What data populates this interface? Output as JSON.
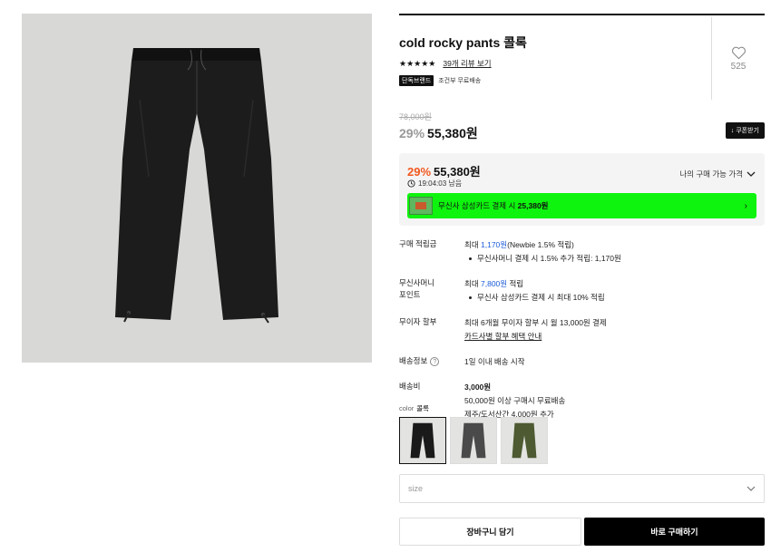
{
  "product": {
    "title": "cold rocky pants 콜록",
    "stars": "★★★★★",
    "review_link": "39개 리뷰 보기",
    "badge_exclusive": "단독브랜드",
    "badge_shipping": "조건부 무료배송",
    "like_count": "525",
    "image_alt": "black pants"
  },
  "price": {
    "original": "78,000원",
    "discount_pct": "29%",
    "current": "55,380원",
    "coupon_label": "↓ 쿠폰받기"
  },
  "my_price": {
    "discount_pct": "29%",
    "price": "55,380원",
    "timer": "19:04:03 남음",
    "label": "나의 구매 가능 가격",
    "card_text_prefix": "무신사 삼성카드 결제 시",
    "card_price": "25,380원",
    "banner_color": "#0ef40e",
    "discount_color": "#f2581f"
  },
  "details": {
    "points_label": "구매 적립금",
    "points_prefix": "최대",
    "points_value": "1,170원",
    "points_suffix": "(Newbie 1.5% 적립)",
    "points_sub": "무신사머니 결제 시 1.5% 추가 적립: 1,170원",
    "money_label_1": "무신사머니",
    "money_label_2": "포인트",
    "money_prefix": "최대",
    "money_value": "7,800원",
    "money_suffix": "적립",
    "money_sub": "무신사 삼성카드 결제 시 최대 10% 적립",
    "installment_label": "무이자 할부",
    "installment_text": "최대 6개월 무이자 할부 시 월 13,000원 결제",
    "installment_link": "카드사별 할부 혜택 안내",
    "delivery_label": "배송정보",
    "delivery_text": "1일 이내 배송 시작",
    "fee_label": "배송비",
    "fee_value": "3,000원",
    "fee_line2": "50,000원 이상 구매시 무료배송",
    "fee_line3": "제주/도서산간 4,000원 추가",
    "link_color": "#1b5bd8"
  },
  "options": {
    "color_label": "color",
    "color_selected": "콜록",
    "size_placeholder": "size",
    "swatches": [
      "black",
      "charcoal",
      "khaki"
    ]
  },
  "actions": {
    "cart": "장바구니 담기",
    "buy": "바로 구매하기"
  }
}
